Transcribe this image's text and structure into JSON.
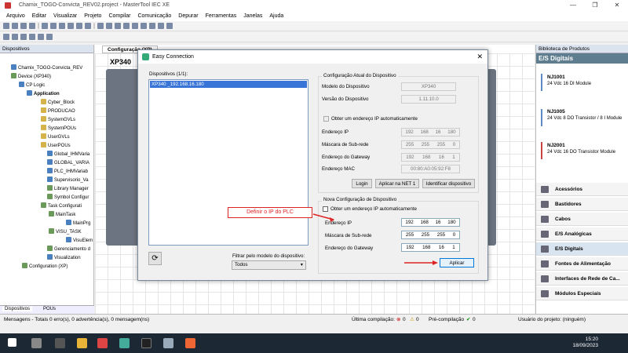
{
  "app": {
    "title": "Chamix_TOGO-Convicta_REV02.project - MasterTool IEC XE"
  },
  "menu": [
    "Arquivo",
    "Editar",
    "Visualizar",
    "Projeto",
    "Compilar",
    "Comunicação",
    "Depurar",
    "Ferramentas",
    "Janelas",
    "Ajuda"
  ],
  "left_panel": {
    "title": "Dispositivos",
    "tree": [
      "Chamix_TOGO-Convicta_REV",
      "Device (XP340)",
      "CP Logic",
      "Application",
      "Cyber_Block",
      "PRODUCAO",
      "SystemGVLs",
      "SystemPOUs",
      "UserGVLs",
      "UserPOUs",
      "Global_IHMVaria",
      "GLOBAL_VARIA",
      "PLC_IHMVariab",
      "Supervisorio_Va",
      "Library Manager",
      "Symbol Configur",
      "Task Configurati",
      "MainTask",
      "MainPrg",
      "VISU_TASK",
      "VisuElem",
      "Gerenciamento d",
      "Visualization",
      "Configuration (XP)"
    ],
    "tabs": [
      "Dispositivos",
      "POUs"
    ]
  },
  "center": {
    "tab": "Configuração (XP)",
    "plc_label": "XP340"
  },
  "dialog": {
    "title": "Easy Connection",
    "devices_label": "Dispositivos (1/1):",
    "devices": [
      "XP340 _192.168.16.180"
    ],
    "filter_label": "Filtrar pelo modelo do dispositivo:",
    "filter_value": "Todos",
    "current": {
      "header": "Configuração Atual do Dispositivo",
      "model_label": "Modelo do Dispositivo",
      "model": "XP340",
      "version_label": "Versão do Dispositivo",
      "version": "1.11.10.0",
      "auto_ip": "Obter um endereço IP automaticamente",
      "ip_label": "Endereço IP",
      "ip": [
        "192",
        "168",
        "16",
        "180"
      ],
      "mask_label": "Máscara de Sub-rede",
      "mask": [
        "255",
        "255",
        "255",
        "0"
      ],
      "gw_label": "Endereço do Gateway",
      "gw": [
        "192",
        "168",
        "16",
        "1"
      ],
      "mac_label": "Endereço MAC",
      "mac": "00:80:A0:05:92:F8",
      "btn_login": "Login",
      "btn_net": "Aplicar na NET 1",
      "btn_identify": "Identificar dispositivo"
    },
    "new": {
      "header": "Nova Configuração de Dispositivo",
      "auto_ip": "Obter um endereço IP automaticamente",
      "ip_label": "Endereço IP",
      "ip": [
        "192",
        "168",
        "16",
        "180"
      ],
      "mask_label": "Máscara de Sub-rede",
      "mask": [
        "255",
        "255",
        "255",
        "0"
      ],
      "gw_label": "Endereço do Gateway",
      "gw": [
        "192",
        "168",
        "16",
        "1"
      ],
      "btn_apply": "Aplicar"
    }
  },
  "callout": "Definir o IP do PLC",
  "right_panel": {
    "title": "Biblioteca de Produtos",
    "category": "E/S Digitais",
    "products": [
      {
        "code": "NJ1001",
        "desc": "24 Vdc 16 DI Module"
      },
      {
        "code": "NJ1005",
        "desc": "24 Vdc 8 DO Transistor / 8 I Module"
      },
      {
        "code": "NJ2001",
        "desc": "24 Vdc 16 DO Transistor Module"
      }
    ],
    "categories": [
      "Acessórios",
      "Bastidores",
      "Cabos",
      "E/S Analógicas",
      "E/S Digitais",
      "Fontes de Alimentação",
      "Interfaces de Rede de Ca...",
      "Módulos Especiais"
    ]
  },
  "status": {
    "messages": "Mensagens - Totais 0 erro(s), 0 advertência(s), 0 mensagem(ns)",
    "last_compile": "Última compilação:",
    "err": "0",
    "warn": "0",
    "precompile": "Pré-compilação",
    "pc_count": "0",
    "user": "Usuário do projeto: (ninguém)"
  },
  "clock": {
    "time": "15:20",
    "date": "18/09/2023"
  }
}
